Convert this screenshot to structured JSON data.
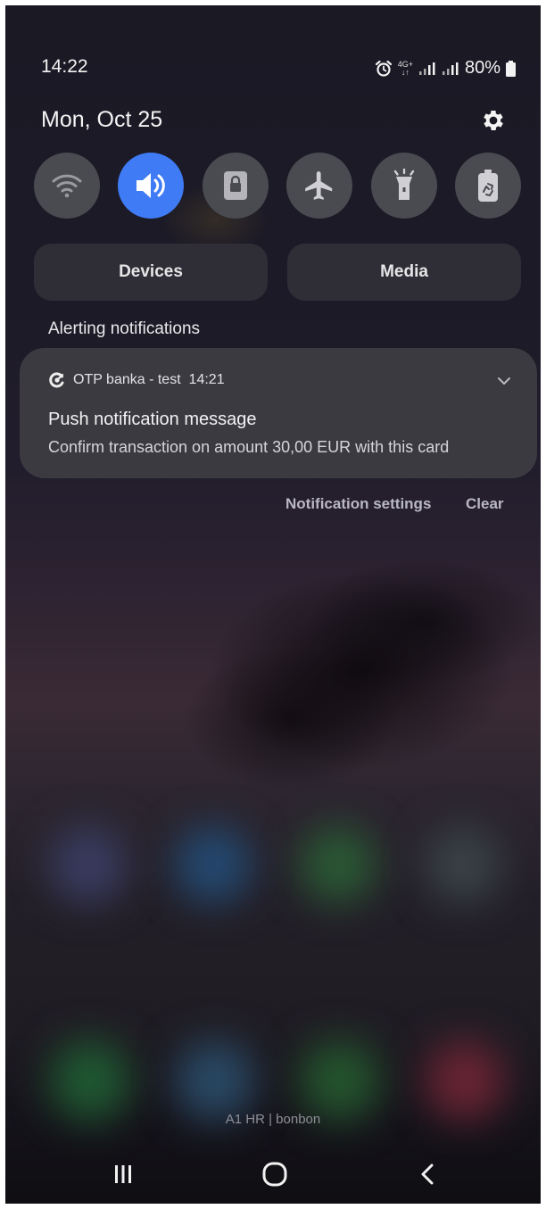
{
  "status_bar": {
    "time": "14:22",
    "network_top": "4G+",
    "battery": "80%"
  },
  "date": "Mon, Oct 25",
  "quick_settings": [
    {
      "name": "wifi-icon",
      "active": false
    },
    {
      "name": "sound-icon",
      "active": true
    },
    {
      "name": "screen-lock-icon",
      "active": false
    },
    {
      "name": "airplane-icon",
      "active": false
    },
    {
      "name": "flashlight-icon",
      "active": false
    },
    {
      "name": "power-saving-icon",
      "active": false
    }
  ],
  "buttons": {
    "devices": "Devices",
    "media": "Media"
  },
  "section_title": "Alerting notifications",
  "notification": {
    "app_name": "OTP banka - test",
    "time": "14:21",
    "title": "Push notification message",
    "body": "Confirm transaction on amount 30,00 EUR with this card"
  },
  "actions": {
    "settings": "Notification settings",
    "clear": "Clear"
  },
  "carrier": "A1 HR | bonbon",
  "colors": {
    "accent": "#3e7bf4",
    "tile": "#4a4a51",
    "card": "#3b3a40"
  }
}
